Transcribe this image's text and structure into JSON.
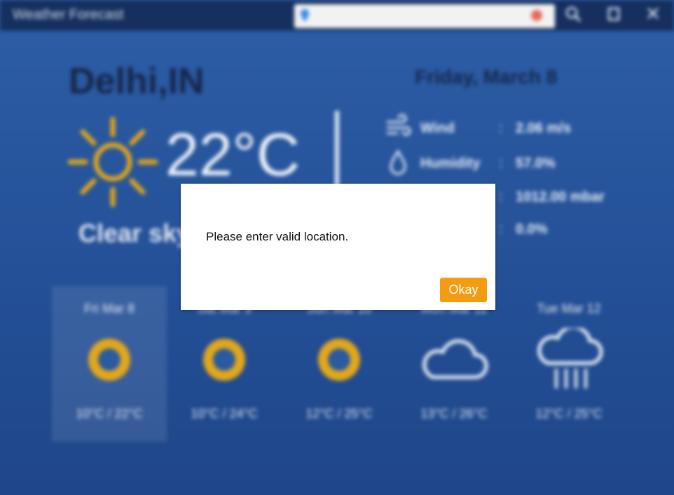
{
  "app": {
    "title": "Weather Forecast"
  },
  "search": {
    "value": "",
    "placeholder": ""
  },
  "current": {
    "city": "Delhi,IN",
    "date": "Friday, March 8",
    "temperature": "22°C",
    "condition": "Clear sky",
    "metrics": [
      {
        "label": "Wind",
        "sep": ":",
        "value": "2.06 m/s"
      },
      {
        "label": "Humidity",
        "sep": ":",
        "value": "57.0%"
      },
      {
        "label": "",
        "sep": ":",
        "value": "1012.00 mbar"
      },
      {
        "label": "",
        "sep": ":",
        "value": "0.0%"
      }
    ]
  },
  "forecast": [
    {
      "day": "Fri Mar 8",
      "range": "10°C / 22°C",
      "icon": "sun-icon"
    },
    {
      "day": "Sat Mar 9",
      "range": "10°C / 24°C",
      "icon": "sun-icon"
    },
    {
      "day": "Sun Mar 10",
      "range": "12°C / 25°C",
      "icon": "sun-icon"
    },
    {
      "day": "Mon Mar 11",
      "range": "13°C / 26°C",
      "icon": "cloud-icon"
    },
    {
      "day": "Tue Mar 12",
      "range": "12°C / 25°C",
      "icon": "rain-cloud-icon"
    }
  ],
  "dialog": {
    "message": "Please enter valid location.",
    "ok_label": "Okay"
  },
  "colors": {
    "accent": "#f39c12",
    "background": "#234f96",
    "titlebar": "#15305f",
    "sun": "#e2a71b"
  }
}
